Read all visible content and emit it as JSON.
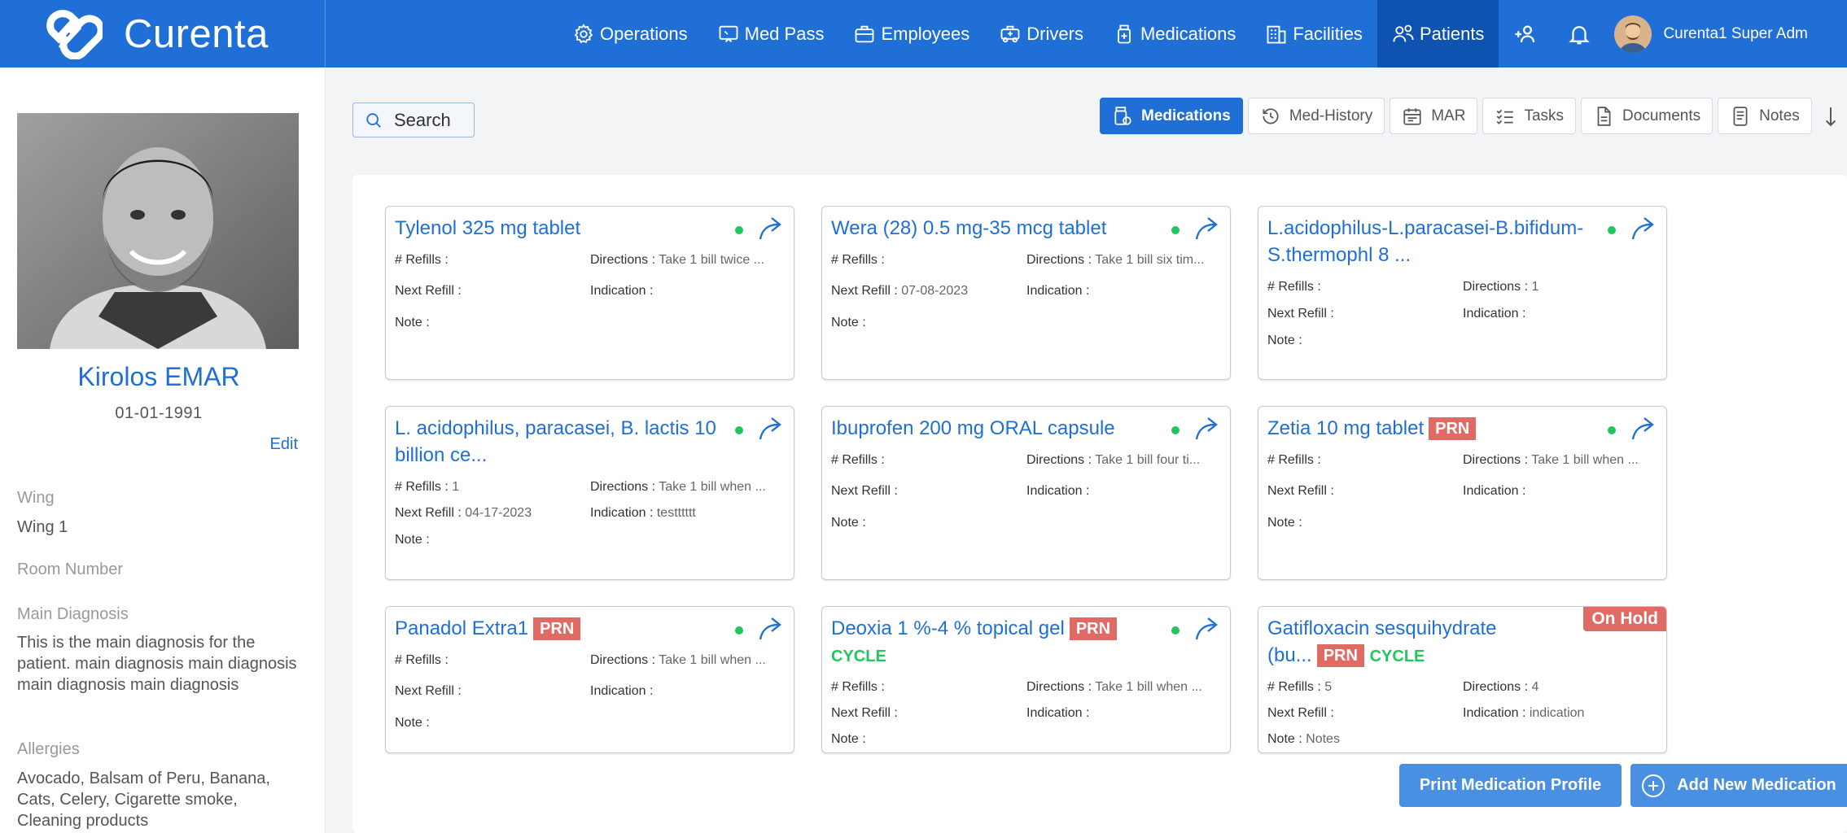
{
  "app": {
    "name": "Curenta"
  },
  "nav": {
    "items": [
      {
        "label": "Operations",
        "icon": "gear-icon"
      },
      {
        "label": "Med Pass",
        "icon": "med-pass-icon"
      },
      {
        "label": "Employees",
        "icon": "briefcase-icon"
      },
      {
        "label": "Drivers",
        "icon": "ambulance-icon"
      },
      {
        "label": "Medications",
        "icon": "medication-bottle-icon"
      },
      {
        "label": "Facilities",
        "icon": "building-icon"
      },
      {
        "label": "Patients",
        "icon": "patients-icon",
        "active": true
      }
    ],
    "user_name": "Curenta1 Super Adm"
  },
  "patient": {
    "name": "Kirolos EMAR",
    "dob": "01-01-1991",
    "edit_label": "Edit",
    "wing_label": "Wing",
    "wing_value": "Wing 1",
    "room_label": "Room Number",
    "diagnosis_label": "Main Diagnosis",
    "diagnosis_value": "This is the main diagnosis for the patient. main diagnosis main diagnosis main diagnosis main diagnosis",
    "allergies_label": "Allergies",
    "allergies_value": "Avocado, Balsam of Peru, Banana, Cats, Celery, Cigarette smoke, Cleaning products"
  },
  "search": {
    "label": "Search"
  },
  "tabs": [
    {
      "label": "Medications",
      "active": true
    },
    {
      "label": "Med-History"
    },
    {
      "label": "MAR"
    },
    {
      "label": "Tasks"
    },
    {
      "label": "Documents"
    },
    {
      "label": "Notes"
    }
  ],
  "field_labels": {
    "refills": "# Refills :",
    "next_refill": "Next Refill :",
    "note": "Note :",
    "directions": "Directions :",
    "indication": "Indication :"
  },
  "medications": [
    {
      "title": "Tylenol 325 mg tablet",
      "refills": "",
      "next_refill": "",
      "note": "",
      "directions": "Take 1 bill twice ...",
      "indication": ""
    },
    {
      "title": "Wera (28) 0.5 mg-35 mcg tablet",
      "refills": "",
      "next_refill": "07-08-2023",
      "note": "",
      "directions": "Take 1 bill six tim...",
      "indication": ""
    },
    {
      "title": "L.acidophilus-L.paracasei-B.bifidum-S.thermophl 8 ...",
      "refills": "",
      "next_refill": "",
      "note": "",
      "directions": "1",
      "indication": ""
    },
    {
      "title": "L. acidophilus, paracasei, B. lactis 10 billion ce...",
      "refills": "1",
      "next_refill": "04-17-2023",
      "note": "",
      "directions": "Take 1 bill when ...",
      "indication": "testttttt"
    },
    {
      "title": "Ibuprofen 200 mg ORAL capsule",
      "refills": "",
      "next_refill": "",
      "note": "",
      "directions": "Take 1 bill four ti...",
      "indication": ""
    },
    {
      "title": "Zetia 10 mg tablet",
      "prn": "PRN",
      "refills": "",
      "next_refill": "",
      "note": "",
      "directions": "Take 1 bill when ...",
      "indication": ""
    },
    {
      "title": "Panadol Extra1",
      "prn": "PRN",
      "refills": "",
      "next_refill": "",
      "note": "",
      "directions": "Take 1 bill when ...",
      "indication": ""
    },
    {
      "title": "Deoxia 1 %-4 % topical gel",
      "prn": "PRN",
      "cycle": "CYCLE",
      "refills": "",
      "next_refill": "",
      "note": "",
      "directions": "Take 1 bill when ...",
      "indication": ""
    },
    {
      "title": "Gatifloxacin sesquihydrate (bu...",
      "prn": "PRN",
      "cycle": "CYCLE",
      "hold": "On Hold",
      "refills": "5",
      "next_refill": "",
      "note": "Notes",
      "directions": "4",
      "indication": "indication"
    }
  ],
  "buttons": {
    "print_profile": "Print Medication Profile",
    "add_medication": "Add New Medication"
  },
  "colors": {
    "primary": "#1f6fd6",
    "active_nav": "#0e53b0",
    "badge": "#e06b65",
    "status_green": "#22c55e",
    "button": "#4a90e2"
  }
}
